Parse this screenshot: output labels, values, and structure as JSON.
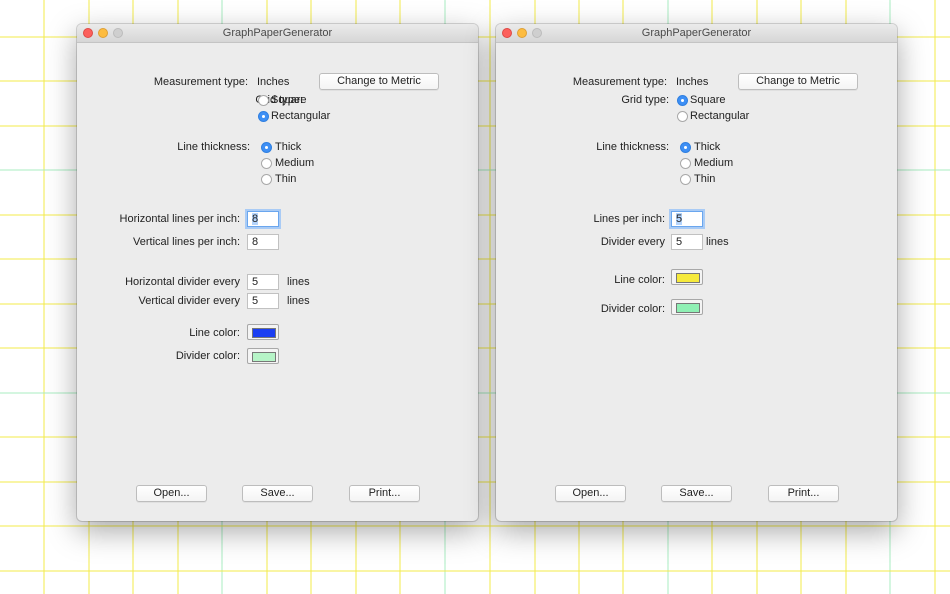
{
  "background": {
    "grid_line_color": "#f3eb4a",
    "divider_line_color": "#a8ecc1"
  },
  "left_window": {
    "title": "GraphPaperGenerator",
    "measurement_label": "Measurement type:",
    "measurement_value": "Inches",
    "change_units_button": "Change to Metric",
    "grid_type_label": "Grid type:",
    "grid_type_options": [
      "Square",
      "Rectangular"
    ],
    "grid_type_selected": "Rectangular",
    "line_thickness_label": "Line thickness:",
    "line_thickness_options": [
      "Thick",
      "Medium",
      "Thin"
    ],
    "line_thickness_selected": "Thick",
    "horizontal_lines_label": "Horizontal lines per inch:",
    "horizontal_lines_value": "8",
    "vertical_lines_label": "Vertical lines per inch:",
    "vertical_lines_value": "8",
    "horizontal_divider_label": "Horizontal divider every",
    "horizontal_divider_value": "5",
    "vertical_divider_label": "Vertical  divider every",
    "vertical_divider_value": "5",
    "lines_unit": "lines",
    "line_color_label": "Line color:",
    "line_color": "#1b3ef2",
    "divider_color_label": "Divider color:",
    "divider_color": "#b6f4c7",
    "open_button": "Open...",
    "save_button": "Save...",
    "print_button": "Print..."
  },
  "right_window": {
    "title": "GraphPaperGenerator",
    "measurement_label": "Measurement type:",
    "measurement_value": "Inches",
    "change_units_button": "Change to Metric",
    "grid_type_label": "Grid type:",
    "grid_type_options": [
      "Square",
      "Rectangular"
    ],
    "grid_type_selected": "Square",
    "line_thickness_label": "Line thickness:",
    "line_thickness_options": [
      "Thick",
      "Medium",
      "Thin"
    ],
    "line_thickness_selected": "Thick",
    "lines_per_inch_label": "Lines per inch:",
    "lines_per_inch_value": "5",
    "divider_every_label": "Divider every",
    "divider_every_value": "5",
    "lines_unit": "lines",
    "line_color_label": "Line color:",
    "line_color": "#f6ea3c",
    "divider_color_label": "Divider color:",
    "divider_color": "#8ff0b4",
    "open_button": "Open...",
    "save_button": "Save...",
    "print_button": "Print..."
  }
}
